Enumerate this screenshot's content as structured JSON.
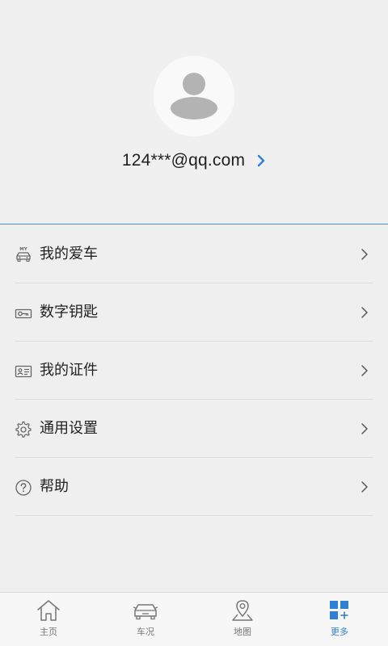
{
  "profile": {
    "account": "124***@qq.com"
  },
  "menu": [
    {
      "label": "我的爱车",
      "icon": "my-car-icon"
    },
    {
      "label": "数字钥匙",
      "icon": "key-icon"
    },
    {
      "label": "我的证件",
      "icon": "id-card-icon"
    },
    {
      "label": "通用设置",
      "icon": "gear-icon"
    },
    {
      "label": "帮助",
      "icon": "help-icon"
    }
  ],
  "tabs": [
    {
      "label": "主页",
      "icon": "home-icon",
      "active": false
    },
    {
      "label": "车况",
      "icon": "car-status-icon",
      "active": false
    },
    {
      "label": "地图",
      "icon": "map-pin-icon",
      "active": false
    },
    {
      "label": "更多",
      "icon": "more-grid-icon",
      "active": true
    }
  ],
  "colors": {
    "accent": "#2f7fd6",
    "background": "#efefef",
    "divider": "#dcdcdc"
  }
}
